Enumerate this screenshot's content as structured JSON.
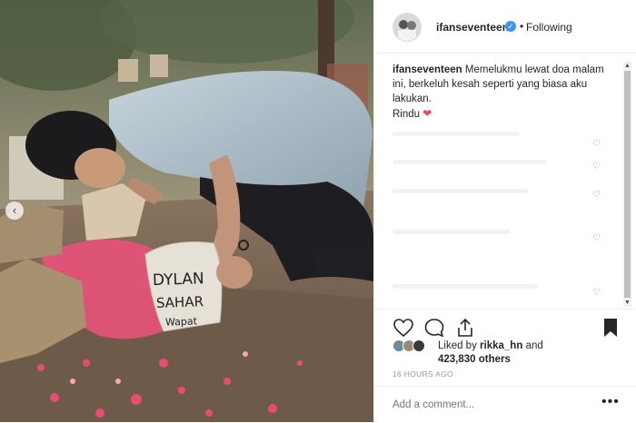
{
  "post": {
    "username": "ifanseventeen",
    "verified_icon": "verified-check-icon",
    "separator": "•",
    "follow_status": "Following",
    "caption_user": "ifanseventeen",
    "caption_text": "Memelukmu lewat doa malam ini, berkeluh kesah seperti yang biasa aku lakukan.",
    "caption_line2": "Rindu",
    "liked_prefix": "Liked by",
    "liked_user": "rikka_hn",
    "liked_and": "and",
    "liked_count": "423,830 others",
    "timestamp": "16 HOURS AGO",
    "comment_placeholder": "Add a comment...",
    "more_label": "•••",
    "carousel_prev": "‹"
  },
  "photo": {
    "headstone_text_1": "DYLAN",
    "headstone_text_2": "SAHAR",
    "headstone_text_3": "Wapat"
  },
  "colors": {
    "accent_blue": "#3897f0",
    "heart_red": "#ed4956",
    "text": "#262626",
    "muted": "#999999"
  }
}
